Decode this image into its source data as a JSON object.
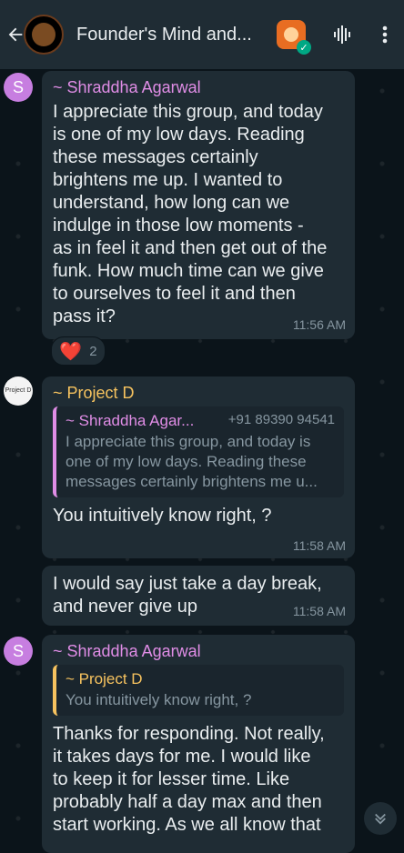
{
  "header": {
    "title": "Founder's Mind and...",
    "back_icon": "arrow-left-icon",
    "voice_icon": "audio-wave-icon",
    "menu_icon": "more-vertical-icon"
  },
  "messages": [
    {
      "avatar_letter": "S",
      "sender": "~ Shraddha Agarwal",
      "lines": [
        "I appreciate this group, and today",
        "is one of my low days. Reading",
        "these messages certainly",
        "brightens me up. I wanted to",
        "understand, how long can we",
        "indulge in those low moments -",
        "as in feel it and then get out of the",
        "funk. How much time can we give",
        "to ourselves to feel it and then",
        "pass it?"
      ],
      "time": "11:56 AM",
      "reaction": {
        "emoji": "❤️",
        "count": "2"
      }
    },
    {
      "avatar_text": "Project D",
      "sender": "~ Project D",
      "quote": {
        "name": "~ Shraddha Agar...",
        "phone": "+91 89390 94541",
        "lines": [
          "I appreciate this group, and today is",
          "one of my low days. Reading these",
          "messages certainly brightens me u..."
        ]
      },
      "text": "You intuitively know right, ?",
      "time": "11:58 AM"
    },
    {
      "lines": [
        "I would say just take a day break,",
        "and never give up"
      ],
      "time": "11:58 AM"
    },
    {
      "avatar_letter": "S",
      "sender": "~ Shraddha Agarwal",
      "quote": {
        "name": "~ Project D",
        "text": "You intuitively know right, ?"
      },
      "lines": [
        "Thanks for responding. Not really,",
        "it takes days for me. I would like",
        "to keep it for lesser time. Like",
        "probably half a day max and then",
        "start working. As we all know that"
      ]
    }
  ],
  "colors": {
    "background": "#0b141a",
    "bubble": "#1f2c34",
    "sender_pink": "#e08de6",
    "sender_gold": "#f7c35f",
    "timestamp": "#8696a0"
  }
}
